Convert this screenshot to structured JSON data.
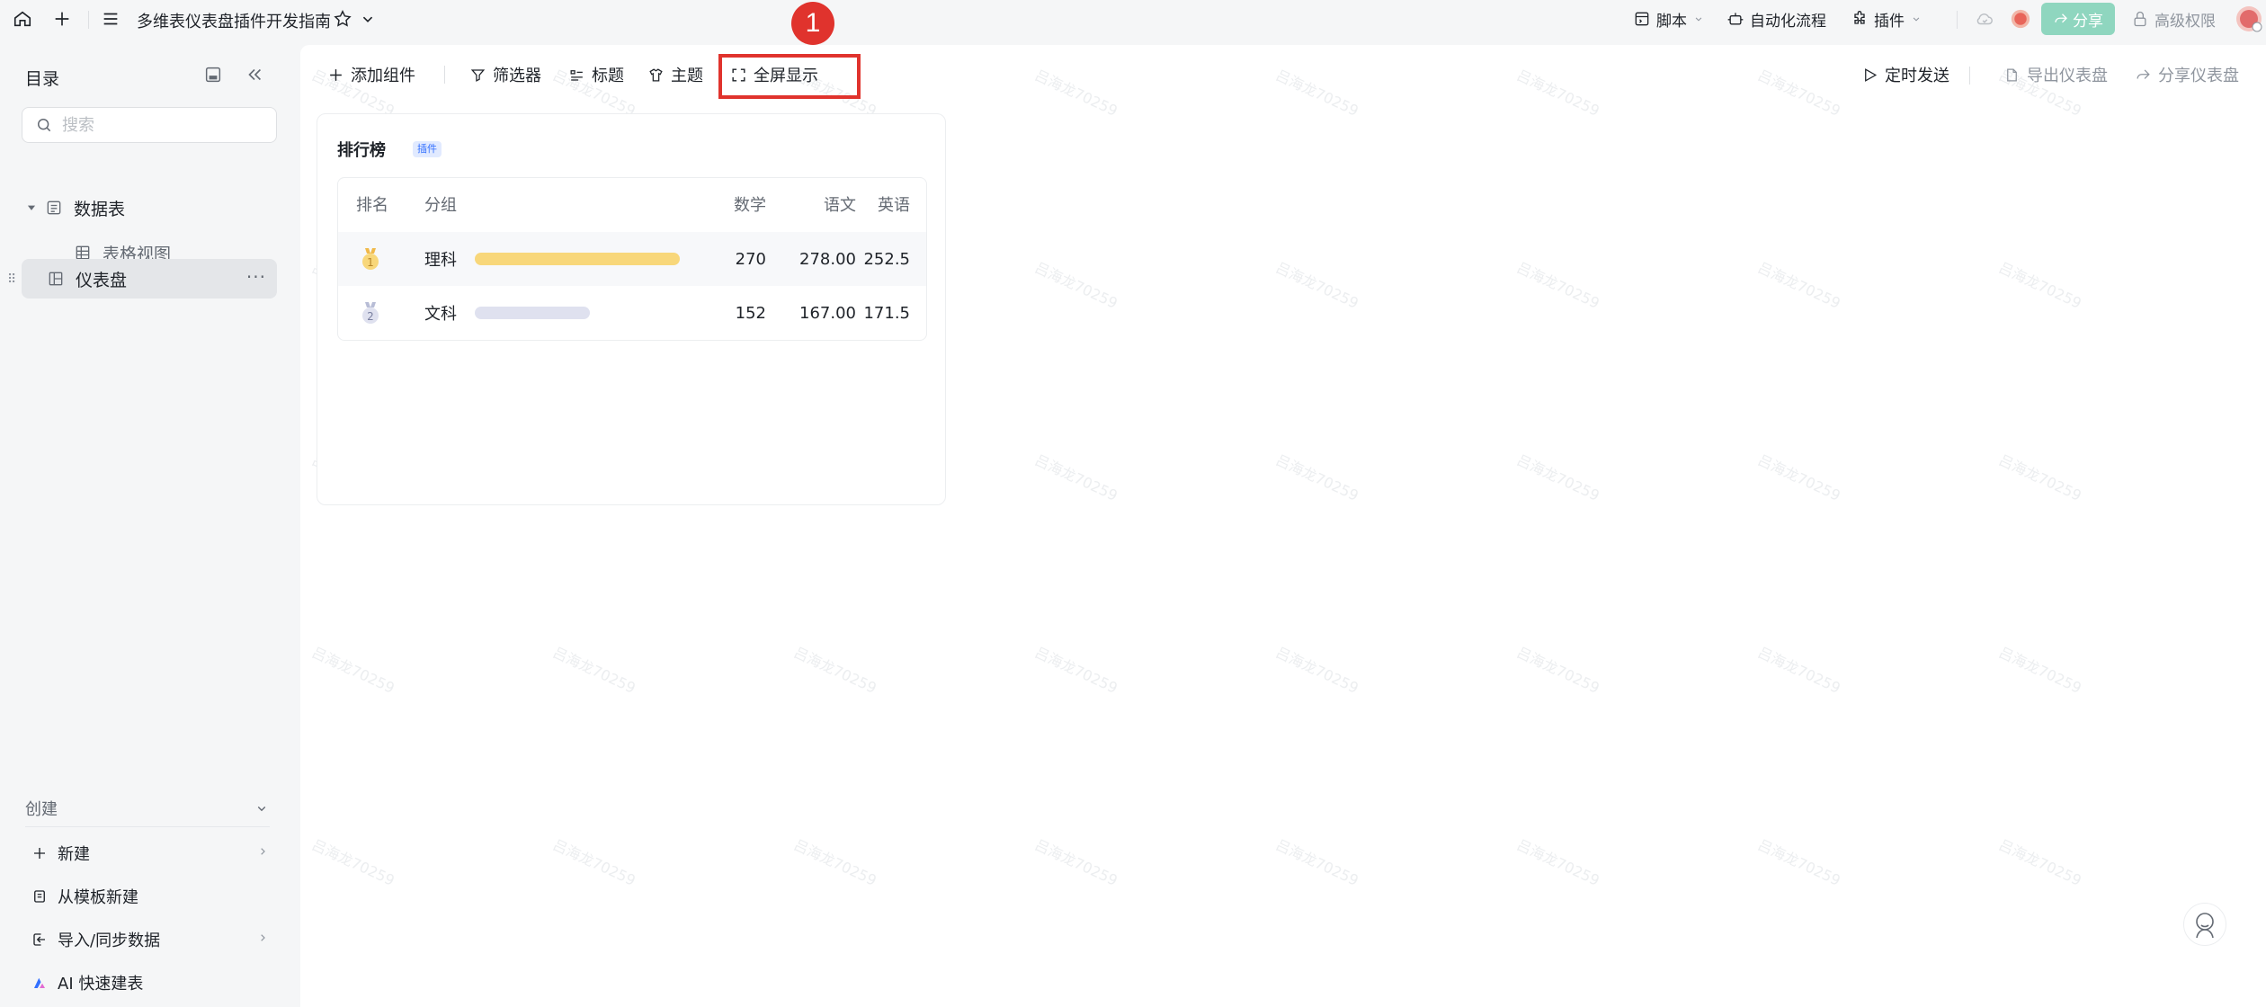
{
  "topbar": {
    "title": "多维表仪表盘插件开发指南",
    "script_label": "脚本",
    "automation_label": "自动化流程",
    "plugin_label": "插件",
    "share_label": "分享",
    "permission_label": "高级权限"
  },
  "sidebar": {
    "header": "目录",
    "search_placeholder": "搜索",
    "items": [
      {
        "label": "数据表"
      },
      {
        "label": "表格视图"
      },
      {
        "label": "仪表盘"
      }
    ],
    "create": {
      "header": "创建",
      "items": [
        {
          "label": "新建"
        },
        {
          "label": "从模板新建"
        },
        {
          "label": "导入/同步数据"
        },
        {
          "label": "AI 快速建表"
        }
      ]
    }
  },
  "toolbar": {
    "add_component": "添加组件",
    "filter": "筛选器",
    "title": "标题",
    "theme": "主题",
    "fullscreen": "全屏显示",
    "scheduled_send": "定时发送",
    "export_dashboard": "导出仪表盘",
    "share_dashboard": "分享仪表盘"
  },
  "annotation": {
    "step": "1"
  },
  "card": {
    "title": "排行榜",
    "tag": "插件",
    "columns": [
      "排名",
      "分组",
      "数学",
      "语文",
      "英语"
    ],
    "rows": [
      {
        "rank": "1",
        "group": "理科",
        "math": "270",
        "chinese": "278.00",
        "english": "252.5",
        "bar_fraction": 1.0,
        "bar_color": "#f8d77a"
      },
      {
        "rank": "2",
        "group": "文科",
        "math": "152",
        "chinese": "167.00",
        "english": "171.5",
        "bar_fraction": 0.563,
        "bar_color": "#dfe1ef"
      }
    ]
  },
  "watermark": "吕海龙70259",
  "colors": {
    "highlight": "#e0332d",
    "share_button": "#8fd6bf",
    "plugin_tag_bg": "#e1eaff",
    "plugin_tag_text": "#3370ff",
    "gold": "#f8d77a",
    "silver": "#dfe1ef"
  }
}
